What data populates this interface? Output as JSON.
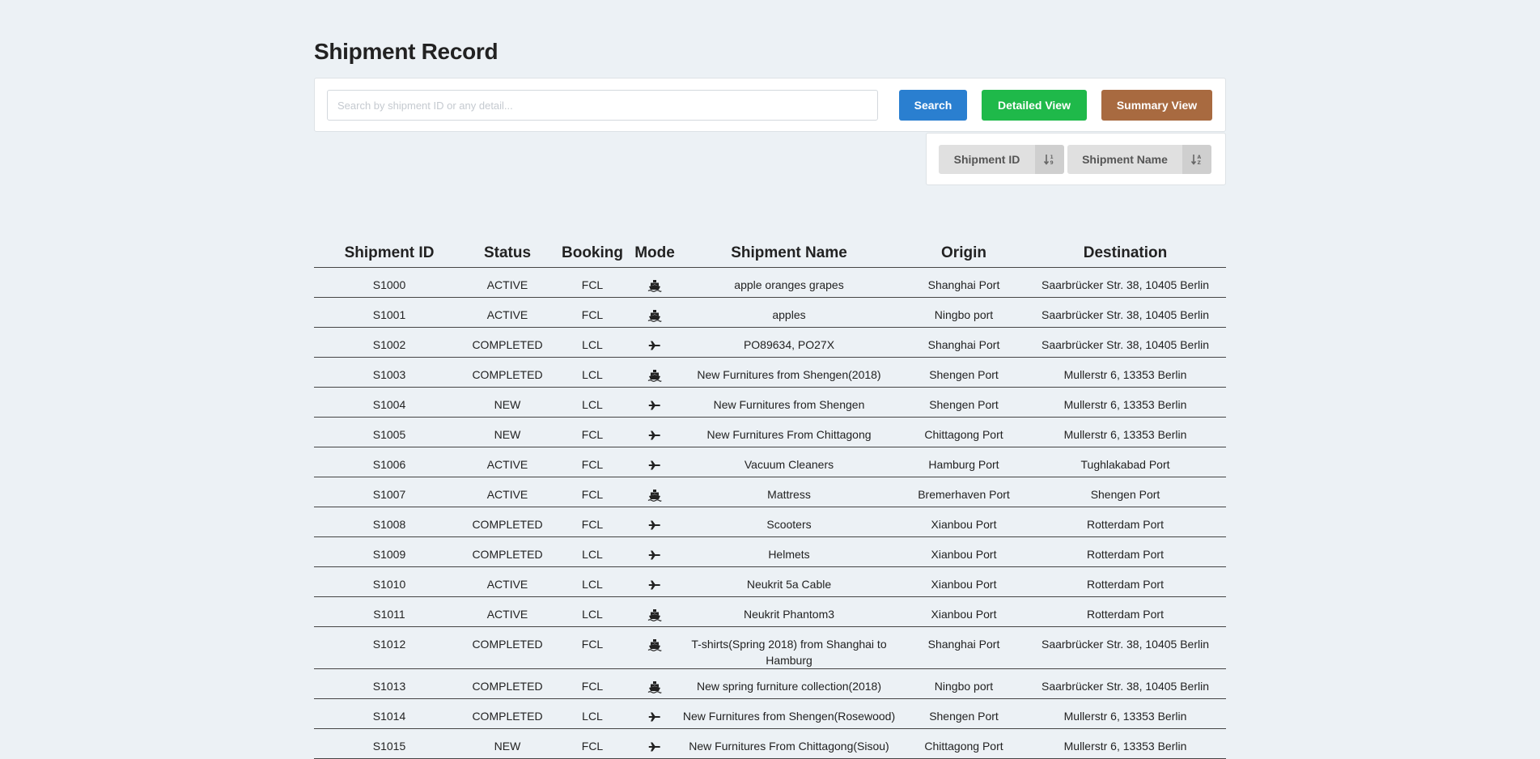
{
  "page": {
    "title": "Shipment Record"
  },
  "toolbar": {
    "search_placeholder": "Search by shipment ID or any detail...",
    "search_value": "",
    "search_label": "Search",
    "detailed_label": "Detailed View",
    "summary_label": "Summary View"
  },
  "sort": {
    "id_label": "Shipment ID",
    "id_icon": "sort-numeric-down-icon",
    "name_label": "Shipment Name",
    "name_icon": "sort-alpha-down-icon"
  },
  "colors": {
    "background": "#ecf1f5",
    "search_button": "#2a7fd0",
    "detailed_button": "#1fb94a",
    "summary_button": "#a86a40"
  },
  "table": {
    "headers": [
      "Shipment ID",
      "Status",
      "Booking",
      "Mode",
      "Shipment Name",
      "Origin",
      "Destination"
    ],
    "rows": [
      {
        "id": "S1000",
        "status": "ACTIVE",
        "booking": "FCL",
        "mode": "ship",
        "name": "apple oranges grapes",
        "origin": "Shanghai Port",
        "destination": "Saarbrücker Str. 38, 10405 Berlin"
      },
      {
        "id": "S1001",
        "status": "ACTIVE",
        "booking": "FCL",
        "mode": "ship",
        "name": "apples",
        "origin": "Ningbo port",
        "destination": "Saarbrücker Str. 38, 10405 Berlin"
      },
      {
        "id": "S1002",
        "status": "COMPLETED",
        "booking": "LCL",
        "mode": "plane",
        "name": "PO89634, PO27X",
        "origin": "Shanghai Port",
        "destination": "Saarbrücker Str. 38, 10405 Berlin"
      },
      {
        "id": "S1003",
        "status": "COMPLETED",
        "booking": "LCL",
        "mode": "ship",
        "name": "New Furnitures from Shengen(2018)",
        "origin": "Shengen Port",
        "destination": "Mullerstr 6, 13353 Berlin"
      },
      {
        "id": "S1004",
        "status": "NEW",
        "booking": "LCL",
        "mode": "plane",
        "name": "New Furnitures from Shengen",
        "origin": "Shengen Port",
        "destination": "Mullerstr 6, 13353 Berlin"
      },
      {
        "id": "S1005",
        "status": "NEW",
        "booking": "FCL",
        "mode": "plane",
        "name": "New Furnitures From Chittagong",
        "origin": "Chittagong Port",
        "destination": "Mullerstr 6, 13353 Berlin"
      },
      {
        "id": "S1006",
        "status": "ACTIVE",
        "booking": "FCL",
        "mode": "plane",
        "name": "Vacuum Cleaners",
        "origin": "Hamburg Port",
        "destination": "Tughlakabad Port"
      },
      {
        "id": "S1007",
        "status": "ACTIVE",
        "booking": "FCL",
        "mode": "ship",
        "name": "Mattress",
        "origin": "Bremerhaven Port",
        "destination": "Shengen Port"
      },
      {
        "id": "S1008",
        "status": "COMPLETED",
        "booking": "FCL",
        "mode": "plane",
        "name": "Scooters",
        "origin": "Xianbou Port",
        "destination": "Rotterdam Port"
      },
      {
        "id": "S1009",
        "status": "COMPLETED",
        "booking": "LCL",
        "mode": "plane",
        "name": "Helmets",
        "origin": "Xianbou Port",
        "destination": "Rotterdam Port"
      },
      {
        "id": "S1010",
        "status": "ACTIVE",
        "booking": "LCL",
        "mode": "plane",
        "name": "Neukrit 5a Cable",
        "origin": "Xianbou Port",
        "destination": "Rotterdam Port"
      },
      {
        "id": "S1011",
        "status": "ACTIVE",
        "booking": "LCL",
        "mode": "ship",
        "name": "Neukrit Phantom3",
        "origin": "Xianbou Port",
        "destination": "Rotterdam Port"
      },
      {
        "id": "S1012",
        "status": "COMPLETED",
        "booking": "FCL",
        "mode": "ship",
        "name": "T-shirts(Spring 2018) from Shanghai to Hamburg",
        "origin": "Shanghai Port",
        "destination": "Saarbrücker Str. 38, 10405 Berlin"
      },
      {
        "id": "S1013",
        "status": "COMPLETED",
        "booking": "FCL",
        "mode": "ship",
        "name": "New spring furniture collection(2018)",
        "origin": "Ningbo port",
        "destination": "Saarbrücker Str. 38, 10405 Berlin"
      },
      {
        "id": "S1014",
        "status": "COMPLETED",
        "booking": "LCL",
        "mode": "plane",
        "name": "New Furnitures from Shengen(Rosewood)",
        "origin": "Shengen Port",
        "destination": "Mullerstr 6, 13353 Berlin"
      },
      {
        "id": "S1015",
        "status": "NEW",
        "booking": "FCL",
        "mode": "plane",
        "name": "New Furnitures From Chittagong(Sisou)",
        "origin": "Chittagong Port",
        "destination": "Mullerstr 6, 13353 Berlin"
      }
    ]
  }
}
